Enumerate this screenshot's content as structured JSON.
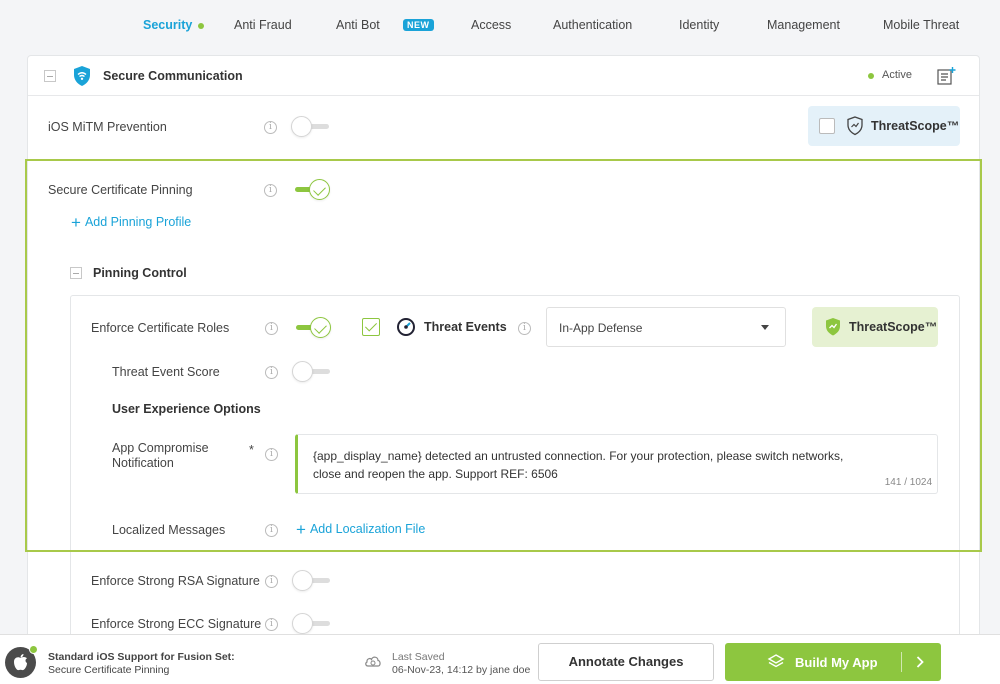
{
  "tabs": [
    {
      "label": "Security",
      "active": true
    },
    {
      "label": "Anti Fraud"
    },
    {
      "label": "Anti Bot",
      "badge": "NEW"
    },
    {
      "label": "Access"
    },
    {
      "label": "Authentication"
    },
    {
      "label": "Identity"
    },
    {
      "label": "Management"
    },
    {
      "label": "Mobile Threat"
    }
  ],
  "section": {
    "title": "Secure Communication",
    "status": "Active",
    "shield_icon": "wifi-shield-icon",
    "notes_icon": "add-note-icon"
  },
  "rows": {
    "ios_mitm": {
      "label": "iOS MiTM Prevention",
      "enabled": false,
      "threatscope_label": "ThreatScope™",
      "threatscope_checked": false
    },
    "pinning": {
      "label": "Secure Certificate Pinning",
      "enabled": true
    },
    "add_pinning": "Add Pinning Profile",
    "pinning_control": "Pinning Control",
    "enforce_roles": {
      "label": "Enforce Certificate Roles",
      "enabled": true,
      "threat_events_checked": true
    },
    "threat_events": "Threat Events",
    "dropdown_value": "In-App Defense",
    "threatscope_label": "ThreatScope™",
    "threat_score": {
      "label": "Threat Event Score",
      "enabled": false
    },
    "ux_options": "User Experience Options",
    "app_compromise": {
      "label_line1": "App Compromise",
      "label_line2": "Notification",
      "required_mark": "*"
    },
    "notification_text": "{app_display_name} detected an untrusted connection. For your protection, please switch networks, close and reopen the app. Support REF: 6506",
    "char_count": "141 / 1024",
    "localized": "Localized Messages",
    "add_localization": "Add Localization File",
    "rsa": {
      "label": "Enforce Strong RSA Signature",
      "enabled": false
    },
    "ecc": {
      "label": "Enforce Strong ECC Signature",
      "enabled": false
    }
  },
  "footer": {
    "support_title": "Standard iOS Support for Fusion Set:",
    "support_sub": "Secure Certificate Pinning",
    "last_saved_label": "Last Saved",
    "last_saved_value": "06-Nov-23, 14:12 by jane doe",
    "annotate": "Annotate Changes",
    "build": "Build My App"
  },
  "colors": {
    "accent_blue": "#1aa3d8",
    "accent_green": "#8dc63f",
    "threatscope_blue_bg": "#e4f1f9",
    "threatscope_green_bg": "#e6f1d2"
  }
}
